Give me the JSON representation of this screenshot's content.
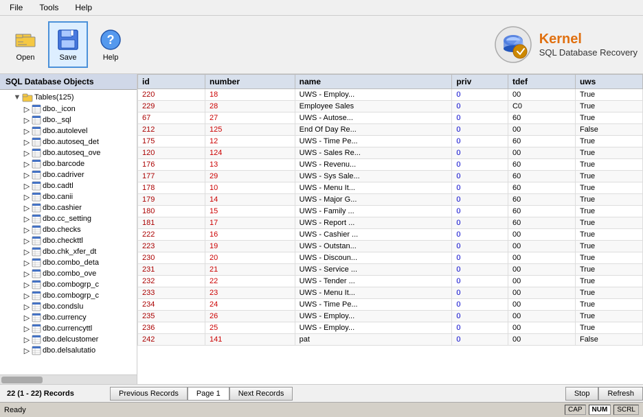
{
  "menu": {
    "items": [
      "File",
      "Tools",
      "Help"
    ]
  },
  "toolbar": {
    "open_label": "Open",
    "save_label": "Save",
    "help_label": "Help"
  },
  "logo": {
    "brand": "Kernel",
    "subtitle": "SQL Database Recovery"
  },
  "sidebar": {
    "header": "SQL Database Objects",
    "root_label": "Tables(125)",
    "items": [
      "dbo._icon",
      "dbo._sql",
      "dbo.autolevel",
      "dbo.autoseq_det",
      "dbo.autoseq_ove",
      "dbo.barcode",
      "dbo.cadriver",
      "dbo.cadtl",
      "dbo.canii",
      "dbo.cashier",
      "dbo.cc_setting",
      "dbo.checks",
      "dbo.checkttl",
      "dbo.chk_xfer_dt",
      "dbo.combo_deta",
      "dbo.combo_ove",
      "dbo.combogrp_c",
      "dbo.combogrp_c",
      "dbo.condslu",
      "dbo.currency",
      "dbo.currencyttl",
      "dbo.delcustomer",
      "dbo.delsalutatio"
    ]
  },
  "table": {
    "columns": [
      "id",
      "number",
      "name",
      "priv",
      "tdef",
      "uws"
    ],
    "rows": [
      {
        "id": "220",
        "number": "18",
        "name": "UWS - Employ...",
        "priv": "0",
        "tdef": "00",
        "uws": "True"
      },
      {
        "id": "229",
        "number": "28",
        "name": "Employee Sales",
        "priv": "0",
        "tdef": "C0",
        "uws": "True"
      },
      {
        "id": "67",
        "number": "27",
        "name": "UWS - Autose...",
        "priv": "0",
        "tdef": "60",
        "uws": "True"
      },
      {
        "id": "212",
        "number": "125",
        "name": "End Of Day Re...",
        "priv": "0",
        "tdef": "00",
        "uws": "False"
      },
      {
        "id": "175",
        "number": "12",
        "name": "UWS - Time Pe...",
        "priv": "0",
        "tdef": "60",
        "uws": "True"
      },
      {
        "id": "120",
        "number": "124",
        "name": "UWS - Sales Re...",
        "priv": "0",
        "tdef": "00",
        "uws": "True"
      },
      {
        "id": "176",
        "number": "13",
        "name": "UWS - Revenu...",
        "priv": "0",
        "tdef": "60",
        "uws": "True"
      },
      {
        "id": "177",
        "number": "29",
        "name": "UWS - Sys Sale...",
        "priv": "0",
        "tdef": "60",
        "uws": "True"
      },
      {
        "id": "178",
        "number": "10",
        "name": "UWS - Menu It...",
        "priv": "0",
        "tdef": "60",
        "uws": "True"
      },
      {
        "id": "179",
        "number": "14",
        "name": "UWS - Major G...",
        "priv": "0",
        "tdef": "60",
        "uws": "True"
      },
      {
        "id": "180",
        "number": "15",
        "name": "UWS - Family ...",
        "priv": "0",
        "tdef": "60",
        "uws": "True"
      },
      {
        "id": "181",
        "number": "17",
        "name": "UWS - Report ...",
        "priv": "0",
        "tdef": "60",
        "uws": "True"
      },
      {
        "id": "222",
        "number": "16",
        "name": "UWS - Cashier ...",
        "priv": "0",
        "tdef": "00",
        "uws": "True"
      },
      {
        "id": "223",
        "number": "19",
        "name": "UWS - Outstan...",
        "priv": "0",
        "tdef": "00",
        "uws": "True"
      },
      {
        "id": "230",
        "number": "20",
        "name": "UWS - Discoun...",
        "priv": "0",
        "tdef": "00",
        "uws": "True"
      },
      {
        "id": "231",
        "number": "21",
        "name": "UWS - Service ...",
        "priv": "0",
        "tdef": "00",
        "uws": "True"
      },
      {
        "id": "232",
        "number": "22",
        "name": "UWS - Tender ...",
        "priv": "0",
        "tdef": "00",
        "uws": "True"
      },
      {
        "id": "233",
        "number": "23",
        "name": "UWS - Menu It...",
        "priv": "0",
        "tdef": "00",
        "uws": "True"
      },
      {
        "id": "234",
        "number": "24",
        "name": "UWS - Time Pe...",
        "priv": "0",
        "tdef": "00",
        "uws": "True"
      },
      {
        "id": "235",
        "number": "26",
        "name": "UWS - Employ...",
        "priv": "0",
        "tdef": "00",
        "uws": "True"
      },
      {
        "id": "236",
        "number": "25",
        "name": "UWS - Employ...",
        "priv": "0",
        "tdef": "00",
        "uws": "True"
      },
      {
        "id": "242",
        "number": "141",
        "name": "pat",
        "priv": "0",
        "tdef": "00",
        "uws": "False"
      }
    ]
  },
  "bottom_bar": {
    "record_info": "22 (1 - 22) Records",
    "prev_label": "Previous Records",
    "page_label": "Page 1",
    "next_label": "Next Records",
    "stop_label": "Stop",
    "refresh_label": "Refresh"
  },
  "status_bar": {
    "ready": "Ready",
    "cap": "CAP",
    "num": "NUM",
    "scrl": "SCRL"
  }
}
